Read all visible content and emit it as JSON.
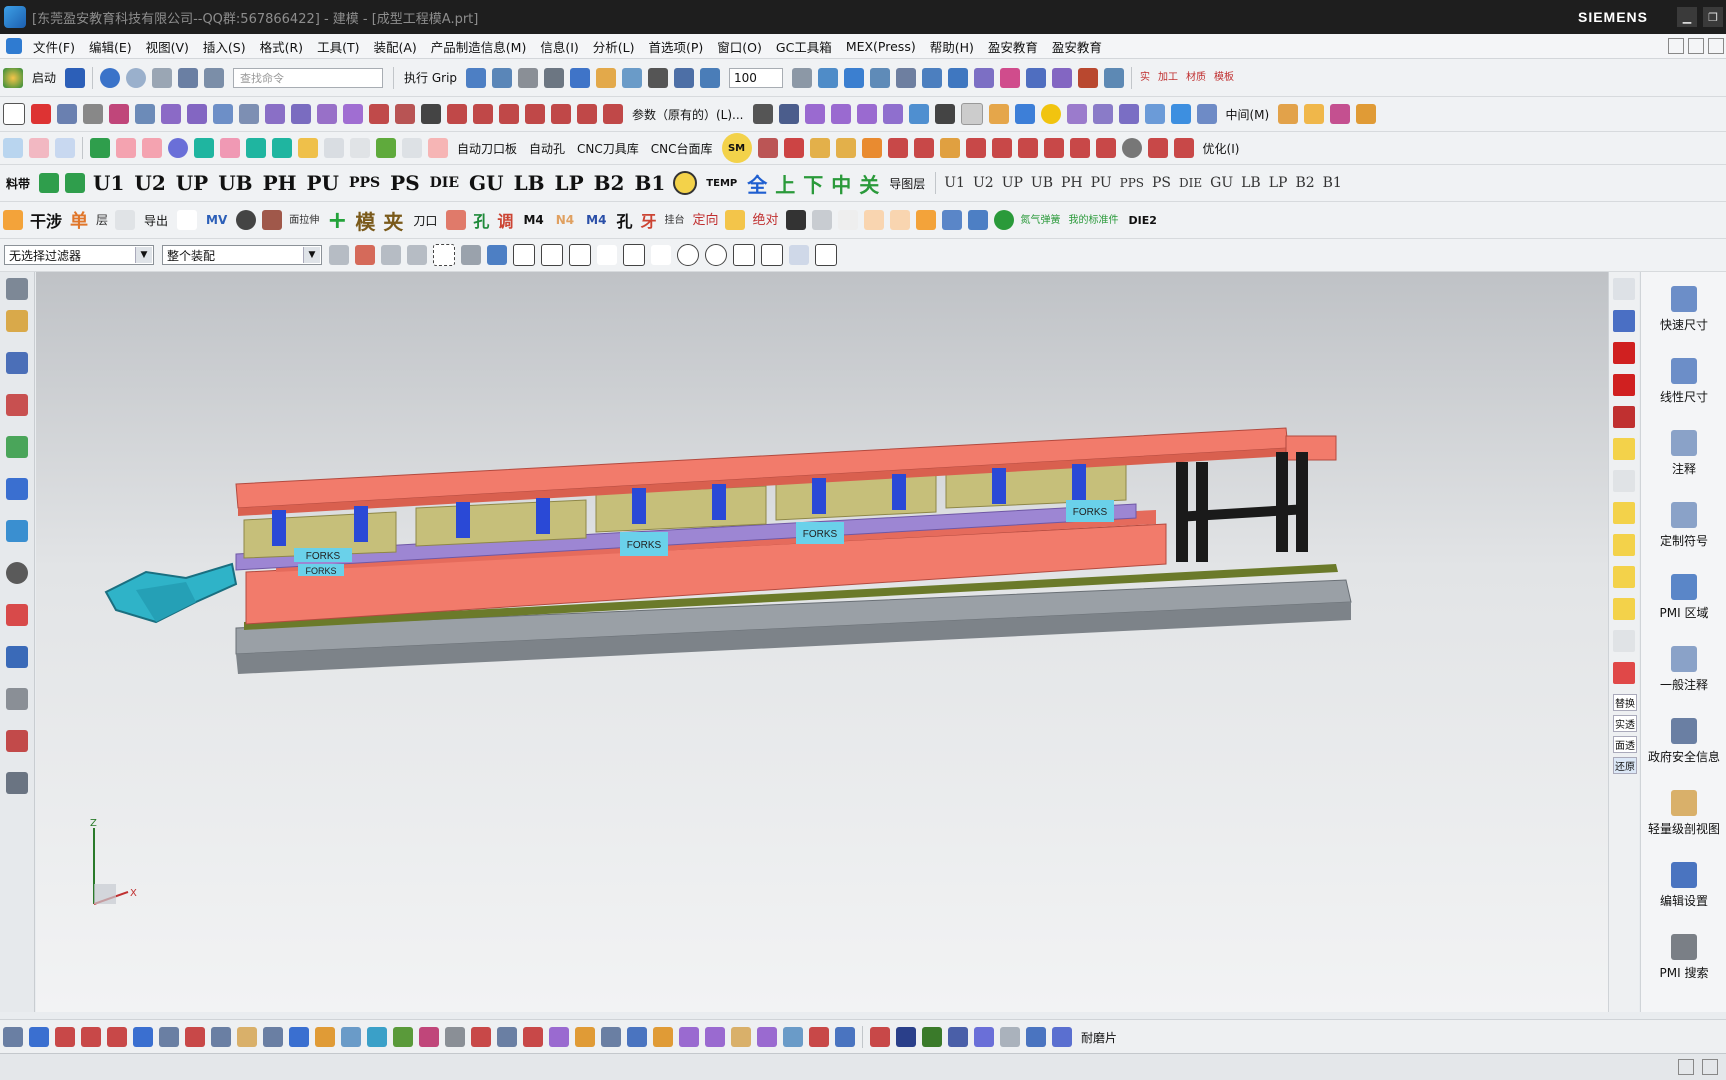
{
  "titlebar": {
    "title": "[东莞盈安教育科技有限公司--QQ群:567866422] - 建模 - [成型工程模A.prt]",
    "brand": "SIEMENS"
  },
  "menu": [
    "文件(F)",
    "编辑(E)",
    "视图(V)",
    "插入(S)",
    "格式(R)",
    "工具(T)",
    "装配(A)",
    "产品制造信息(M)",
    "信息(I)",
    "分析(L)",
    "首选项(P)",
    "窗口(O)",
    "GC工具箱",
    "MEX(Press)",
    "帮助(H)",
    "盈安教育",
    "盈安教育"
  ],
  "toolbar1": {
    "start_label": "启动",
    "search_placeholder": "查找命令",
    "grip_label": "执行 Grip",
    "zoom_value": "100",
    "right_labels": [
      "实",
      "加工",
      "材质",
      "模板"
    ]
  },
  "toolbar2": {
    "param_label": "参数（原有的）(L)...",
    "view_label": "中间(M)"
  },
  "toolbar3": {
    "labels": [
      "自动刀口板",
      "自动孔",
      "CNC刀具库",
      "CNC台面库"
    ],
    "sm_label": "SM",
    "optimize_label": "优化(I)"
  },
  "toolbar4": {
    "first": "料带",
    "big": [
      "U1",
      "U2",
      "UP",
      "UB",
      "PH",
      "PU",
      "PPS",
      "PS",
      "DIE",
      "GU",
      "LB",
      "LP",
      "B2",
      "B1"
    ],
    "temp": "TEMP",
    "cn": [
      "全",
      "上",
      "下",
      "中",
      "关"
    ],
    "layer": "导图层",
    "small": [
      "U1",
      "U2",
      "UP",
      "UB",
      "PH",
      "PU",
      "PPS",
      "PS",
      "DIE",
      "GU",
      "LB",
      "LP",
      "B2",
      "B1"
    ]
  },
  "toolbar5": {
    "labels": [
      "干涉",
      "单",
      "层",
      "导出",
      "MV",
      "面拉伸",
      "模",
      "夹",
      "刀口",
      "孔",
      "调",
      "M4",
      "N4",
      "M4",
      "孔",
      "牙",
      "挂台",
      "定向",
      "绝对",
      "氮气弹簧",
      "我的标准件",
      "DIE2"
    ]
  },
  "filterbar": {
    "filter_value": "无选择过滤器",
    "scope_value": "整个装配"
  },
  "right_palette": [
    "替换",
    "实透",
    "面透",
    "还原"
  ],
  "pmi_panel": [
    {
      "label": "快速尺寸",
      "icon": "quick-dimension-icon"
    },
    {
      "label": "线性尺寸",
      "icon": "linear-dimension-icon"
    },
    {
      "label": "注释",
      "icon": "note-icon"
    },
    {
      "label": "定制符号",
      "icon": "custom-symbol-icon"
    },
    {
      "label": "PMI 区域",
      "icon": "pmi-region-icon"
    },
    {
      "label": "一般注释",
      "icon": "general-note-icon"
    },
    {
      "label": "政府安全信息",
      "icon": "security-info-icon"
    },
    {
      "label": "轻量级剖视图",
      "icon": "lightweight-section-icon"
    },
    {
      "label": "编辑设置",
      "icon": "edit-settings-icon"
    },
    {
      "label": "PMI 搜索",
      "icon": "pmi-search-icon"
    }
  ],
  "viewport": {
    "die_labels": [
      "FORKS",
      "FORKS",
      "FORKS",
      "FORKS",
      "FORKS"
    ],
    "axis_z": "Z",
    "axis_x": "X"
  },
  "bottombar": {
    "last_label": "耐磨片"
  },
  "colors": {
    "plate_salmon": "#f27b6b",
    "plate_lavender": "#9d86d3",
    "plate_olive": "#c6bf7a",
    "guide_blue": "#2a49d6",
    "base_gray": "#9aa0a6",
    "rail_green": "#6b7a2a",
    "label_cyan": "#6ad1ea"
  }
}
